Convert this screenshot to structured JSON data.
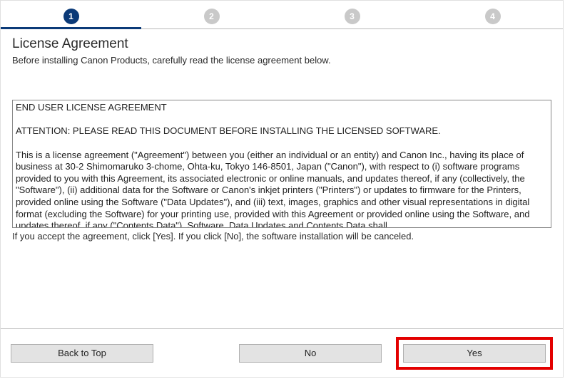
{
  "steps": {
    "items": [
      {
        "num": "1",
        "active": true
      },
      {
        "num": "2",
        "active": false
      },
      {
        "num": "3",
        "active": false
      },
      {
        "num": "4",
        "active": false
      }
    ]
  },
  "page": {
    "title": "License Agreement",
    "subtitle": "Before installing Canon Products, carefully read the license agreement below.",
    "accept_note": "If you accept the agreement, click [Yes]. If you click [No], the software installation will be canceled."
  },
  "license": {
    "text": "END USER LICENSE AGREEMENT\n\nATTENTION: PLEASE READ THIS DOCUMENT BEFORE INSTALLING THE LICENSED SOFTWARE.\n\nThis is a license agreement (\"Agreement\") between you (either an individual or an entity) and Canon Inc., having its place of business at 30-2 Shimomaruko 3-chome, Ohta-ku, Tokyo 146-8501, Japan (\"Canon\"), with respect to (i) software programs provided to you with this Agreement, its associated electronic or online manuals, and updates thereof, if any (collectively, the \"Software\"), (ii) additional data for the Software or Canon's inkjet printers (\"Printers\") or updates to firmware for the Printers, provided online using the Software (\"Data Updates\"), and (iii) text, images, graphics and other visual representations in digital format (excluding the Software) for your printing use, provided with this Agreement or provided online using the Software, and updates thereof, if any (\"Contents Data\"). Software, Data Updates and Contents Data shall"
  },
  "buttons": {
    "back": "Back to Top",
    "no": "No",
    "yes": "Yes"
  }
}
